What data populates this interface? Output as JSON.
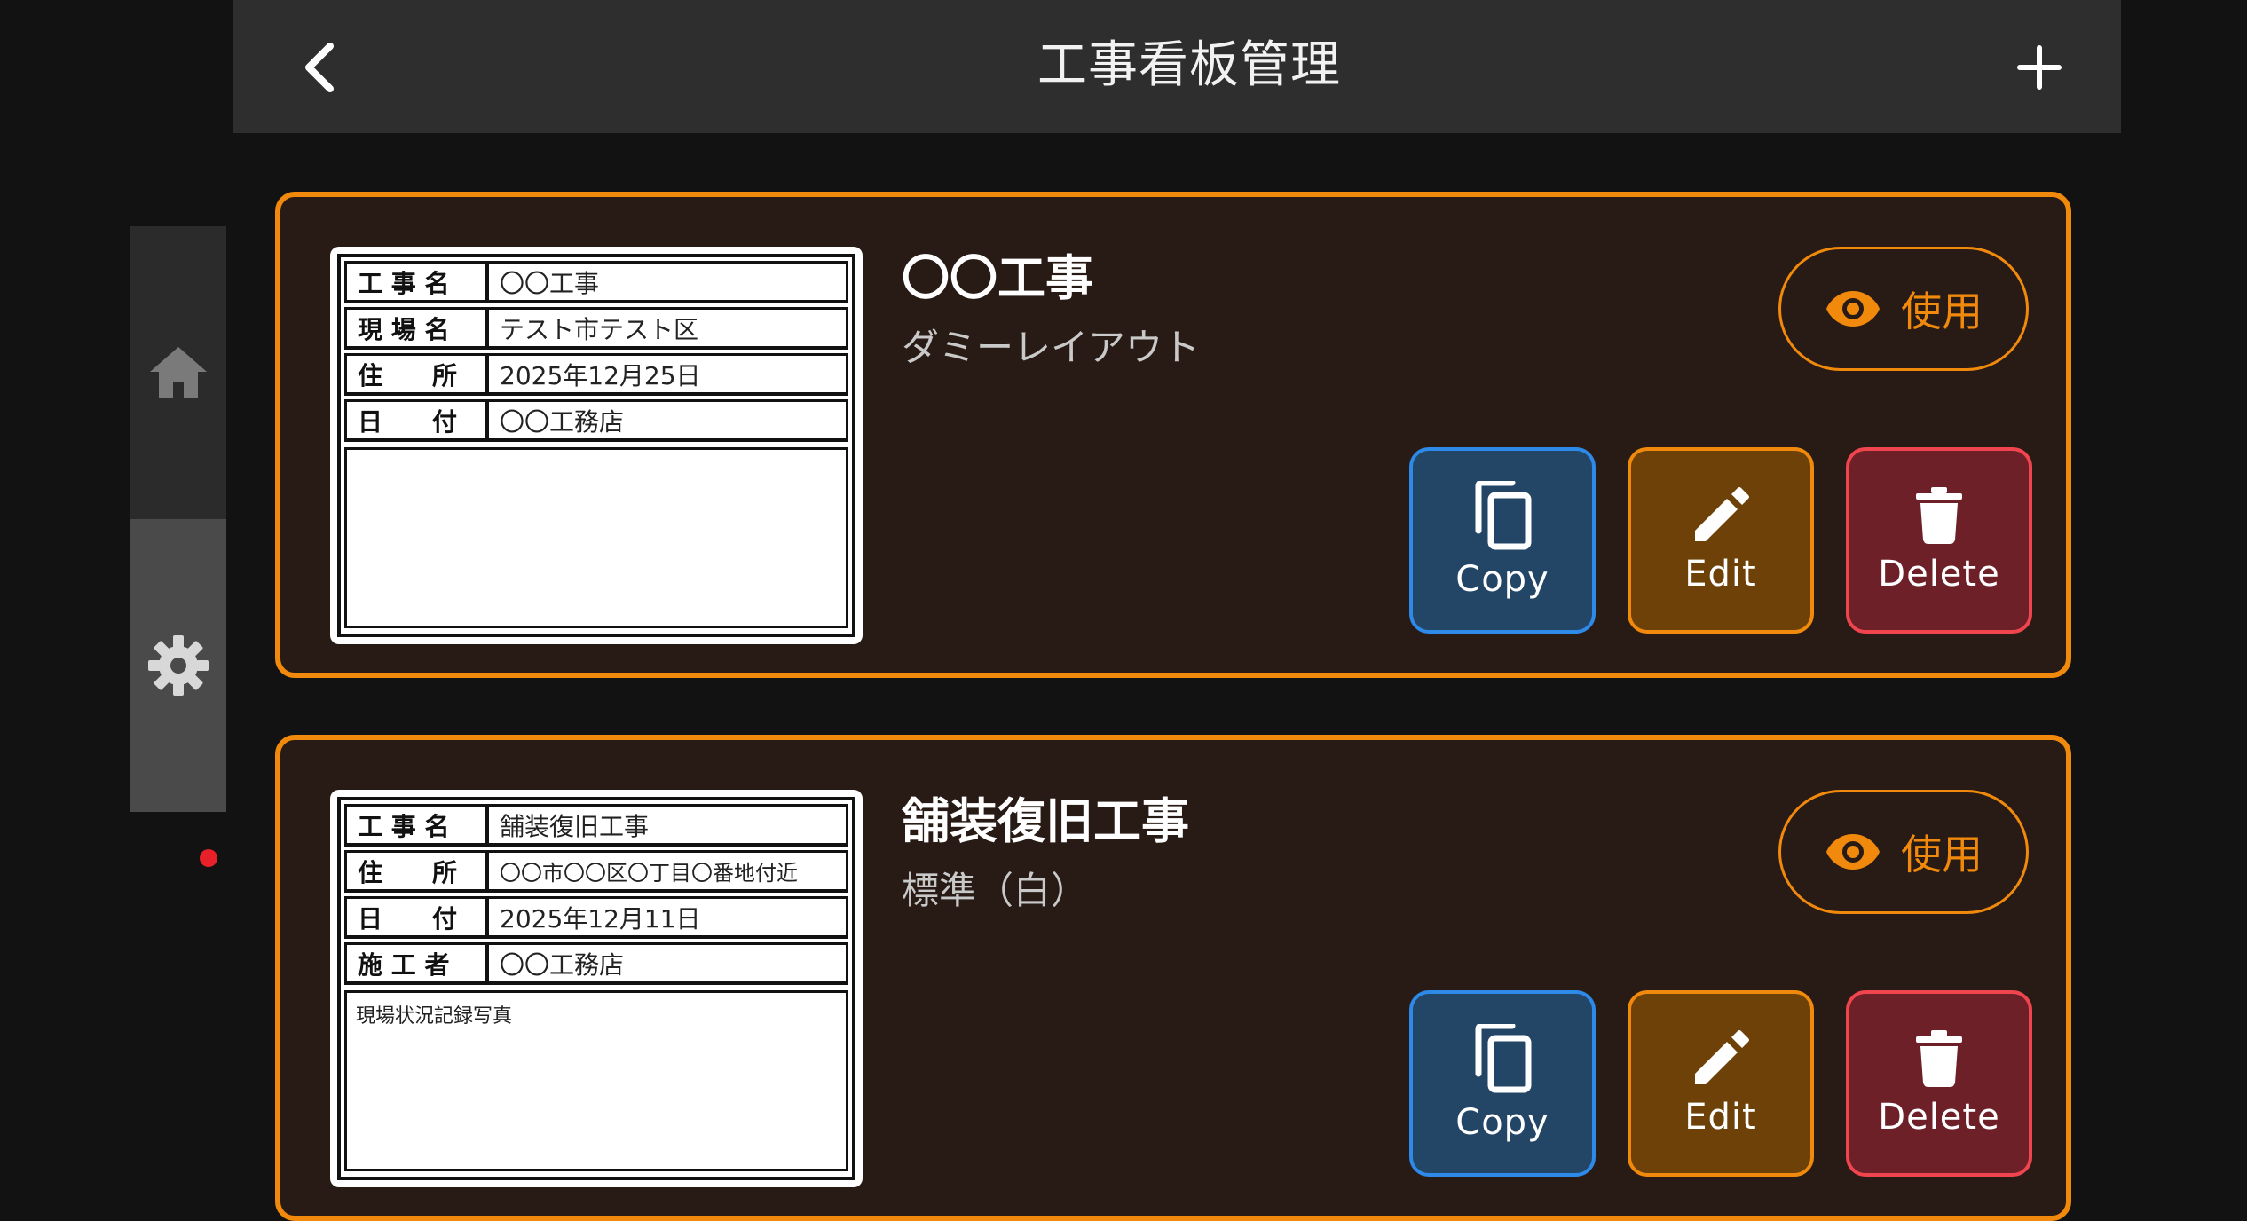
{
  "header": {
    "title": "工事看板管理",
    "back_icon": "chevron-left-icon",
    "add_icon": "plus-icon"
  },
  "side_rail": {
    "items": [
      {
        "icon": "home-icon",
        "active": false
      },
      {
        "icon": "gear-icon",
        "active": true,
        "has_badge": true
      }
    ]
  },
  "colors": {
    "accent": "#f0890c",
    "copy": "#2d8ae8",
    "delete": "#f0444f",
    "card_bg": "#281a14"
  },
  "cards": [
    {
      "name": "〇〇工事",
      "layout": "ダミーレイアウト",
      "use_label": "使用",
      "copy_label": "Copy",
      "edit_label": "Edit",
      "delete_label": "Delete",
      "board_rows": [
        {
          "label": "工 事 名",
          "value": "〇〇工事"
        },
        {
          "label": "現 場 名",
          "value": "テスト市テスト区"
        },
        {
          "label": "住　　所",
          "value": "2025年12月25日"
        },
        {
          "label": "日　　付",
          "value": "〇〇工務店"
        }
      ],
      "board_note": ""
    },
    {
      "name": "舗装復旧工事",
      "layout": "標準（白）",
      "use_label": "使用",
      "copy_label": "Copy",
      "edit_label": "Edit",
      "delete_label": "Delete",
      "board_rows": [
        {
          "label": "工 事 名",
          "value": "舗装復旧工事"
        },
        {
          "label": "住　　所",
          "value": "〇〇市〇〇区〇丁目〇番地付近"
        },
        {
          "label": "日　　付",
          "value": "2025年12月11日"
        },
        {
          "label": "施 工 者",
          "value": "〇〇工務店"
        }
      ],
      "board_note": "現場状況記録写真"
    }
  ]
}
